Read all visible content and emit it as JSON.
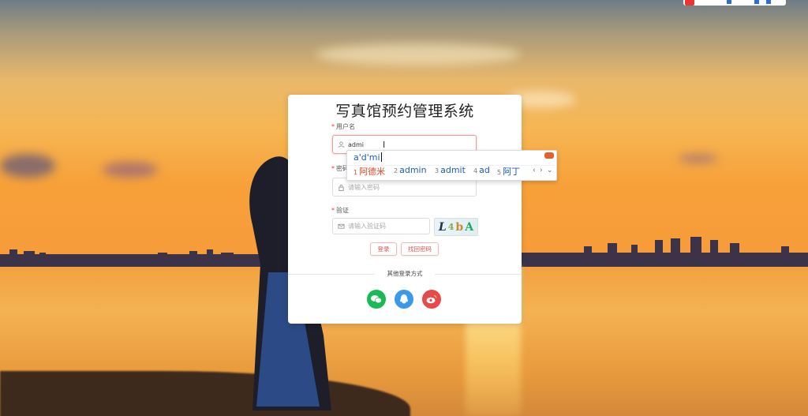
{
  "window": {
    "title": "写真馆预约管理系统"
  },
  "form": {
    "username": {
      "label": "用户名",
      "value": "admi"
    },
    "password": {
      "label": "密码",
      "placeholder": "请输入密码"
    },
    "captcha": {
      "label": "验证",
      "placeholder": "请输入验证码",
      "image_text": [
        "L",
        "4",
        "b",
        "A"
      ]
    },
    "buttons": {
      "login": "登录",
      "find_password": "找回密码"
    },
    "other_login": {
      "label": "其他登录方式",
      "providers": [
        "wechat-icon",
        "qq-icon",
        "weibo-icon"
      ]
    }
  },
  "ime": {
    "composition": "a'd'mi",
    "candidates": [
      {
        "num": "1",
        "text": "阿德米"
      },
      {
        "num": "2",
        "text": "admin"
      },
      {
        "num": "3",
        "text": "admit"
      },
      {
        "num": "4",
        "text": "ad"
      },
      {
        "num": "5",
        "text": "阿丁"
      }
    ],
    "nav": {
      "prev": "‹",
      "next": "›",
      "more": "⌄"
    }
  },
  "colors": {
    "wechat": "#19b955",
    "qq": "#3a9ae9",
    "weibo": "#e64a4a",
    "required": "#ee3333",
    "ime_text": "#1a5fb4",
    "ime_selected": "#e24b26"
  }
}
